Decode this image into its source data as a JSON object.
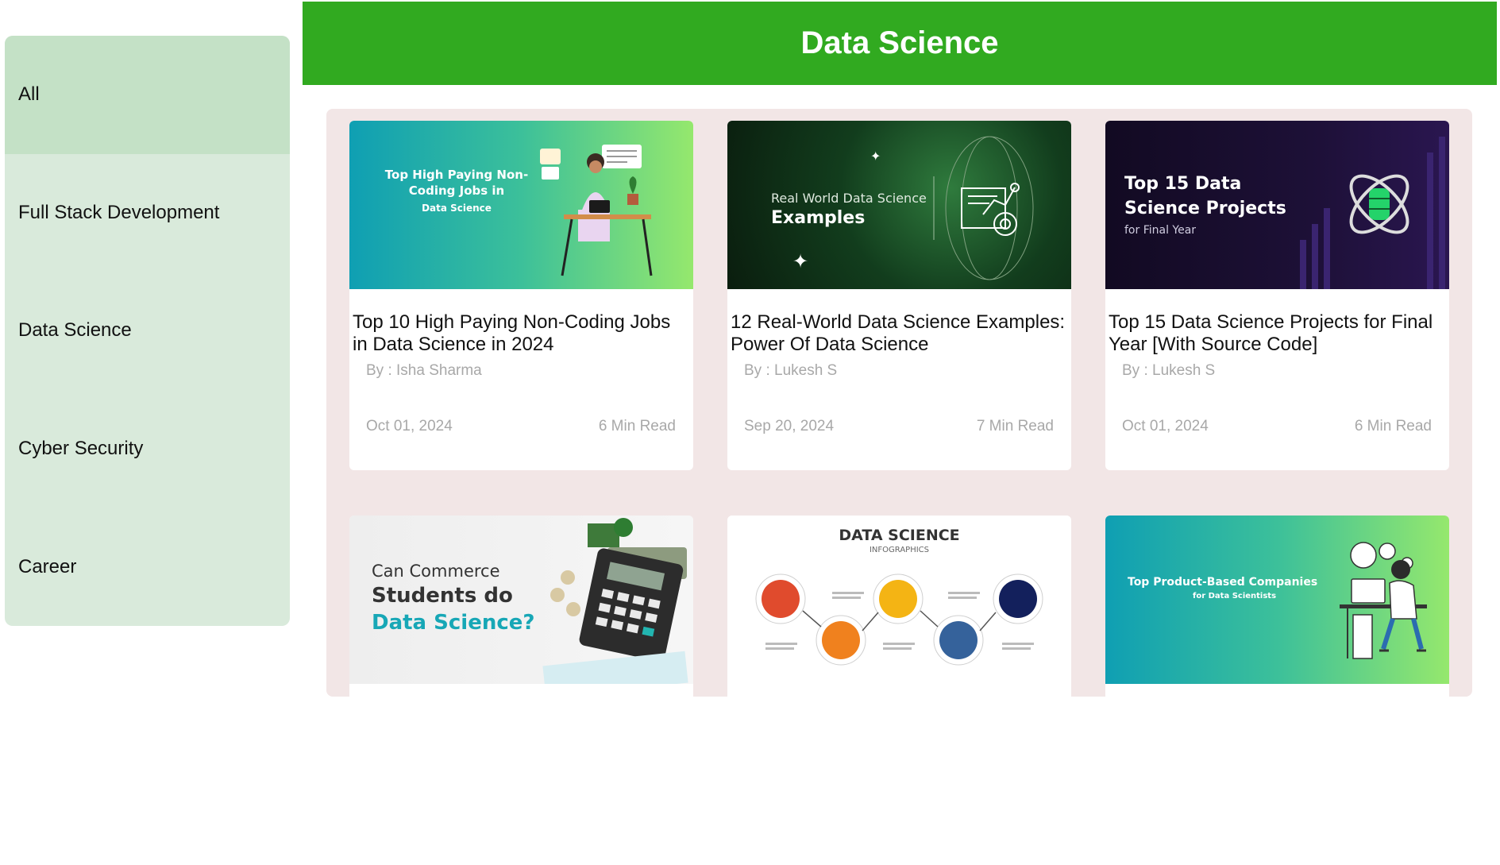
{
  "header": {
    "title": "Data Science"
  },
  "sidebar": {
    "items": [
      {
        "label": "All",
        "active": true
      },
      {
        "label": "Full Stack Development"
      },
      {
        "label": "Data Science"
      },
      {
        "label": "Cyber Security"
      },
      {
        "label": "Career"
      }
    ]
  },
  "cards": [
    {
      "title": "Top 10 High Paying Non-Coding Jobs in Data Science in 2024",
      "author": "By : Isha Sharma",
      "date": "Oct 01, 2024",
      "read_time": "6 Min Read",
      "thumb": {
        "line1": "Top High Paying Non-Coding Jobs in",
        "line2": "Data Science"
      }
    },
    {
      "title": "12 Real-World Data Science Examples: Power Of Data Science",
      "author": "By : Lukesh S",
      "date": "Sep 20, 2024",
      "read_time": "7 Min Read",
      "thumb": {
        "line1": "Real World Data Science",
        "line2": "Examples"
      }
    },
    {
      "title": "Top 15 Data Science Projects for Final Year [With Source Code]",
      "author": "By : Lukesh S",
      "date": "Oct 01, 2024",
      "read_time": "6 Min Read",
      "thumb": {
        "line1": "Top 15 Data Science Projects",
        "line2": "for Final Year"
      }
    },
    {
      "thumb": {
        "line1": "Can Commerce",
        "line2": "Students do",
        "line3": "Data Science?"
      }
    },
    {
      "thumb": {
        "line1": "DATA SCIENCE",
        "line2": "INFOGRAPHICS"
      }
    },
    {
      "thumb": {
        "line1": "Top Product-Based Companies",
        "line2": "for Data Scientists"
      }
    }
  ],
  "colors": {
    "header_bg": "#31aa20",
    "sidebar_bg": "#d9eadb",
    "sidebar_active_bg": "#c4e1c6",
    "panel_bg": "#f2e6e6",
    "meta_text": "#a8a8a8"
  }
}
